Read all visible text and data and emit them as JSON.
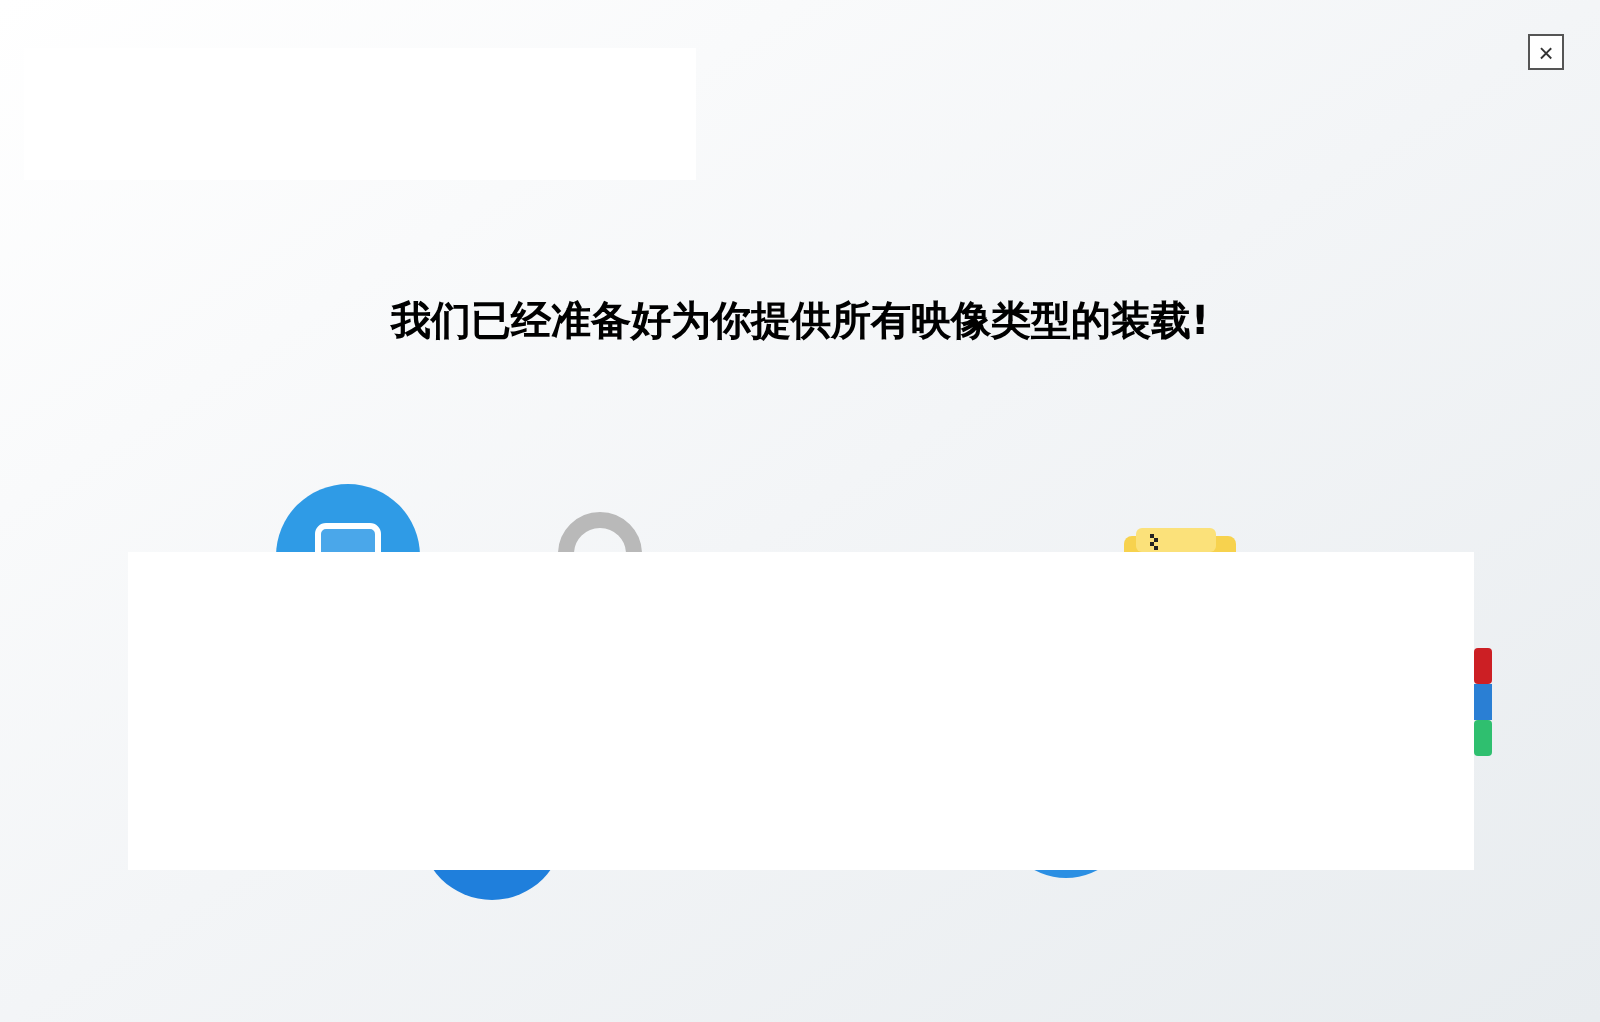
{
  "close_button": "×",
  "heading": "我们已经准备好为你提供所有映像类型的装载!"
}
